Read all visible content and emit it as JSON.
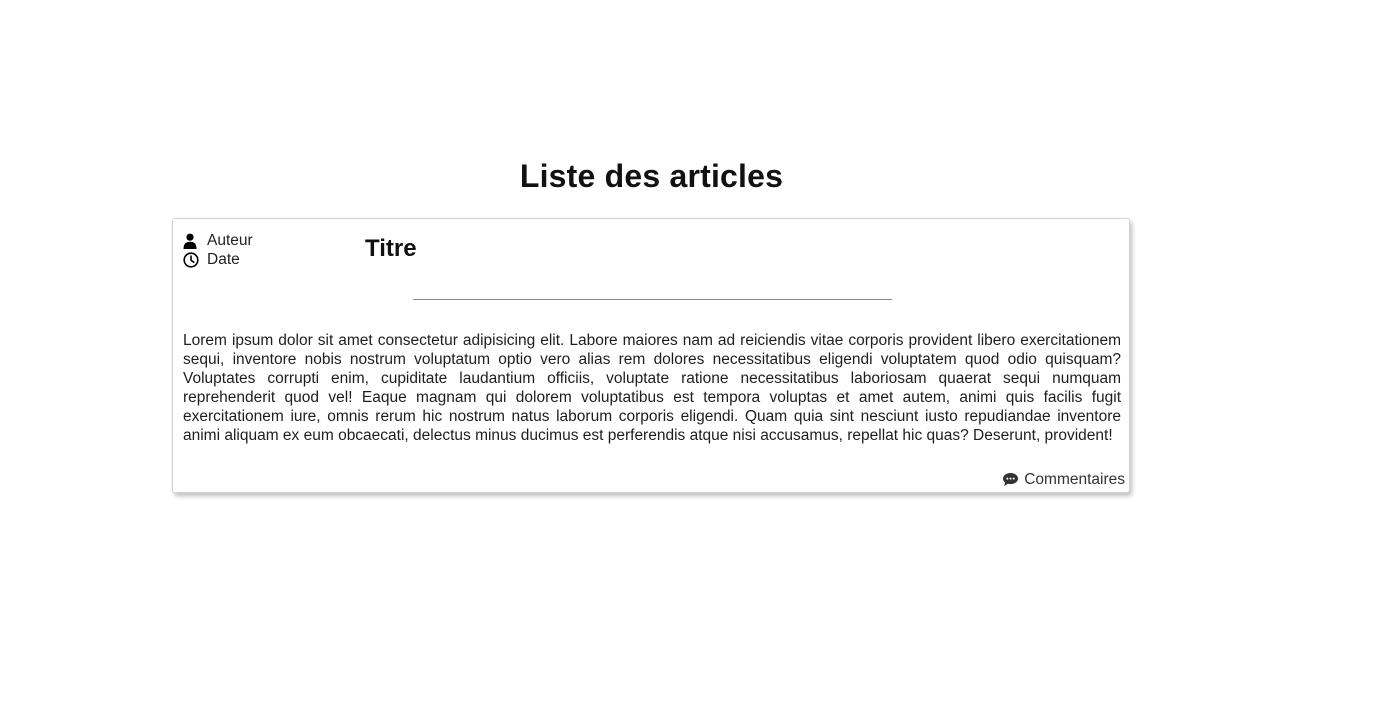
{
  "page": {
    "title": "Liste des articles"
  },
  "article": {
    "author_label": "Auteur",
    "author_icon": "user-icon",
    "date_label": "Date",
    "date_icon": "clock-icon",
    "title": "Titre",
    "body": "Lorem ipsum dolor sit amet consectetur adipisicing elit. Labore maiores nam ad reiciendis vitae corporis provident libero exercitationem sequi, inventore nobis nostrum voluptatum optio vero alias rem dolores necessitatibus eligendi voluptatem quod odio quisquam? Voluptates corrupti enim, cupiditate laudantium officiis, voluptate ratione necessitatibus laboriosam quaerat sequi numquam reprehenderit quod vel! Eaque magnam qui dolorem voluptatibus est tempora voluptas et amet autem, animi quis facilis fugit exercitationem iure, omnis rerum hic nostrum natus laborum corporis eligendi. Quam quia sint nesciunt iusto repudiandae inventore animi aliquam ex eum obcaecati, delectus minus ducimus est perferendis atque nisi accusamus, repellat hic quas? Deserunt, provident!",
    "comments_label": "Commentaires",
    "comments_icon": "comments-icon"
  },
  "colors": {
    "text": "#212121",
    "divider": "#8a8a8a",
    "card_border": "#d4d4d4"
  }
}
